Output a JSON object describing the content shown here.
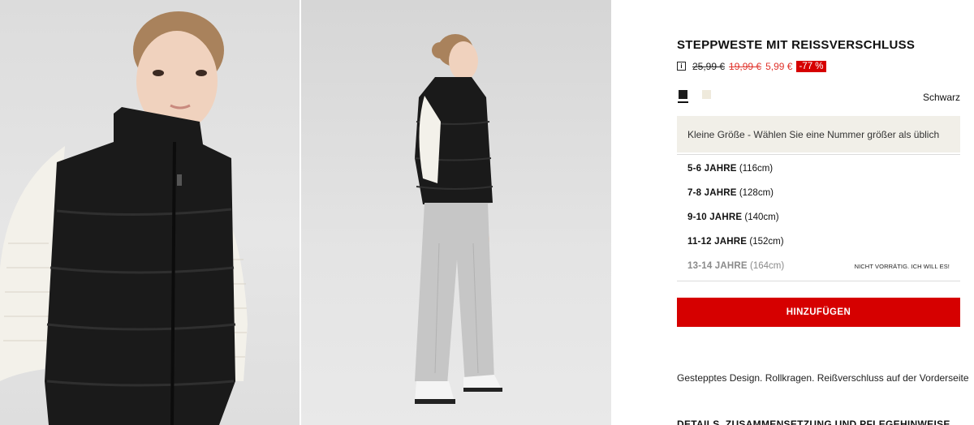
{
  "product": {
    "title": "STEPPWESTE MIT REISSVERSCHLUSS",
    "price_info_icon": "info-icon",
    "price_original": "25,99 €",
    "price_previous": "19,99 €",
    "price_current": "5,99 €",
    "discount": "-77 %",
    "colors": [
      {
        "name": "Schwarz",
        "hex": "#1c1c1c",
        "selected": true
      },
      {
        "name": "cream",
        "hex": "#efeadc",
        "selected": false
      }
    ],
    "selected_color_name": "Schwarz",
    "size_hint": "Kleine Größe - Wählen Sie eine Nummer größer als üblich",
    "sizes": [
      {
        "label": "5-6 JAHRE",
        "cm": "(116cm)",
        "available": true,
        "note": ""
      },
      {
        "label": "7-8 JAHRE",
        "cm": "(128cm)",
        "available": true,
        "note": ""
      },
      {
        "label": "9-10 JAHRE",
        "cm": "(140cm)",
        "available": true,
        "note": ""
      },
      {
        "label": "11-12 JAHRE",
        "cm": "(152cm)",
        "available": true,
        "note": ""
      },
      {
        "label": "13-14 JAHRE",
        "cm": "(164cm)",
        "available": false,
        "note": "NICHT VORRÄTIG. ICH WILL ES!"
      }
    ],
    "add_button": "HINZUFÜGEN",
    "description": "Gestepptes Design. Rollkragen. Reißverschluss auf der Vorderseite",
    "details_link": "DETAILS, ZUSAMMENSETZUNG UND PFLEGEHINWEISE"
  },
  "colors": {
    "accent_red": "#d60000",
    "sale_red": "#e0342c",
    "hint_bg": "#f1efe8"
  }
}
